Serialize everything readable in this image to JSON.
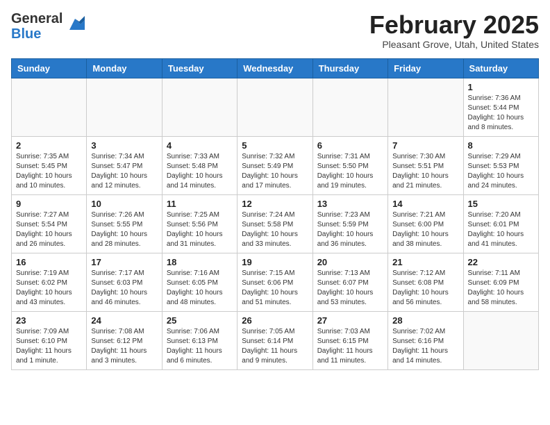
{
  "header": {
    "logo_general": "General",
    "logo_blue": "Blue",
    "month_title": "February 2025",
    "location": "Pleasant Grove, Utah, United States"
  },
  "weekdays": [
    "Sunday",
    "Monday",
    "Tuesday",
    "Wednesday",
    "Thursday",
    "Friday",
    "Saturday"
  ],
  "weeks": [
    [
      {
        "day": "",
        "info": ""
      },
      {
        "day": "",
        "info": ""
      },
      {
        "day": "",
        "info": ""
      },
      {
        "day": "",
        "info": ""
      },
      {
        "day": "",
        "info": ""
      },
      {
        "day": "",
        "info": ""
      },
      {
        "day": "1",
        "info": "Sunrise: 7:36 AM\nSunset: 5:44 PM\nDaylight: 10 hours and 8 minutes."
      }
    ],
    [
      {
        "day": "2",
        "info": "Sunrise: 7:35 AM\nSunset: 5:45 PM\nDaylight: 10 hours and 10 minutes."
      },
      {
        "day": "3",
        "info": "Sunrise: 7:34 AM\nSunset: 5:47 PM\nDaylight: 10 hours and 12 minutes."
      },
      {
        "day": "4",
        "info": "Sunrise: 7:33 AM\nSunset: 5:48 PM\nDaylight: 10 hours and 14 minutes."
      },
      {
        "day": "5",
        "info": "Sunrise: 7:32 AM\nSunset: 5:49 PM\nDaylight: 10 hours and 17 minutes."
      },
      {
        "day": "6",
        "info": "Sunrise: 7:31 AM\nSunset: 5:50 PM\nDaylight: 10 hours and 19 minutes."
      },
      {
        "day": "7",
        "info": "Sunrise: 7:30 AM\nSunset: 5:51 PM\nDaylight: 10 hours and 21 minutes."
      },
      {
        "day": "8",
        "info": "Sunrise: 7:29 AM\nSunset: 5:53 PM\nDaylight: 10 hours and 24 minutes."
      }
    ],
    [
      {
        "day": "9",
        "info": "Sunrise: 7:27 AM\nSunset: 5:54 PM\nDaylight: 10 hours and 26 minutes."
      },
      {
        "day": "10",
        "info": "Sunrise: 7:26 AM\nSunset: 5:55 PM\nDaylight: 10 hours and 28 minutes."
      },
      {
        "day": "11",
        "info": "Sunrise: 7:25 AM\nSunset: 5:56 PM\nDaylight: 10 hours and 31 minutes."
      },
      {
        "day": "12",
        "info": "Sunrise: 7:24 AM\nSunset: 5:58 PM\nDaylight: 10 hours and 33 minutes."
      },
      {
        "day": "13",
        "info": "Sunrise: 7:23 AM\nSunset: 5:59 PM\nDaylight: 10 hours and 36 minutes."
      },
      {
        "day": "14",
        "info": "Sunrise: 7:21 AM\nSunset: 6:00 PM\nDaylight: 10 hours and 38 minutes."
      },
      {
        "day": "15",
        "info": "Sunrise: 7:20 AM\nSunset: 6:01 PM\nDaylight: 10 hours and 41 minutes."
      }
    ],
    [
      {
        "day": "16",
        "info": "Sunrise: 7:19 AM\nSunset: 6:02 PM\nDaylight: 10 hours and 43 minutes."
      },
      {
        "day": "17",
        "info": "Sunrise: 7:17 AM\nSunset: 6:03 PM\nDaylight: 10 hours and 46 minutes."
      },
      {
        "day": "18",
        "info": "Sunrise: 7:16 AM\nSunset: 6:05 PM\nDaylight: 10 hours and 48 minutes."
      },
      {
        "day": "19",
        "info": "Sunrise: 7:15 AM\nSunset: 6:06 PM\nDaylight: 10 hours and 51 minutes."
      },
      {
        "day": "20",
        "info": "Sunrise: 7:13 AM\nSunset: 6:07 PM\nDaylight: 10 hours and 53 minutes."
      },
      {
        "day": "21",
        "info": "Sunrise: 7:12 AM\nSunset: 6:08 PM\nDaylight: 10 hours and 56 minutes."
      },
      {
        "day": "22",
        "info": "Sunrise: 7:11 AM\nSunset: 6:09 PM\nDaylight: 10 hours and 58 minutes."
      }
    ],
    [
      {
        "day": "23",
        "info": "Sunrise: 7:09 AM\nSunset: 6:10 PM\nDaylight: 11 hours and 1 minute."
      },
      {
        "day": "24",
        "info": "Sunrise: 7:08 AM\nSunset: 6:12 PM\nDaylight: 11 hours and 3 minutes."
      },
      {
        "day": "25",
        "info": "Sunrise: 7:06 AM\nSunset: 6:13 PM\nDaylight: 11 hours and 6 minutes."
      },
      {
        "day": "26",
        "info": "Sunrise: 7:05 AM\nSunset: 6:14 PM\nDaylight: 11 hours and 9 minutes."
      },
      {
        "day": "27",
        "info": "Sunrise: 7:03 AM\nSunset: 6:15 PM\nDaylight: 11 hours and 11 minutes."
      },
      {
        "day": "28",
        "info": "Sunrise: 7:02 AM\nSunset: 6:16 PM\nDaylight: 11 hours and 14 minutes."
      },
      {
        "day": "",
        "info": ""
      }
    ]
  ]
}
